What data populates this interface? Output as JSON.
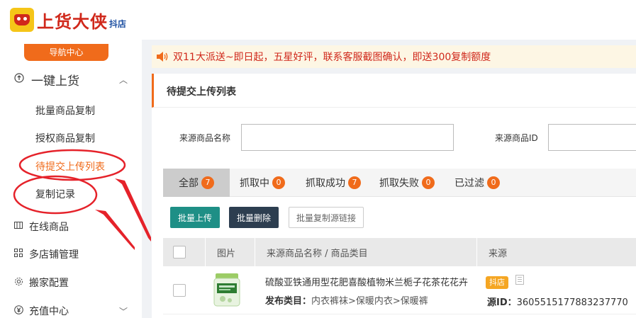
{
  "brand": {
    "name": "上货大侠",
    "sub": "抖店"
  },
  "sidebar": {
    "nav_center": "导航中心",
    "group": {
      "label": "一键上货",
      "icon": "upload-circle-icon",
      "chevron": "︿"
    },
    "sub_items": [
      {
        "label": "批量商品复制"
      },
      {
        "label": "授权商品复制"
      },
      {
        "label": "待提交上传列表"
      },
      {
        "label": "复制记录"
      }
    ],
    "items": [
      {
        "label": "在线商品",
        "icon": "grid-icon"
      },
      {
        "label": "多店铺管理",
        "icon": "apps-icon"
      },
      {
        "label": "搬家配置",
        "icon": "gear-icon"
      },
      {
        "label": "充值中心",
        "icon": "yen-icon",
        "chevron": "﹀"
      }
    ]
  },
  "notice": {
    "text": "双11大派送~即日起，五星好评，联系客服截图确认，即送300复制额度"
  },
  "panel": {
    "title": "待提交上传列表"
  },
  "filters": {
    "name_label": "来源商品名称",
    "id_label": "来源商品ID",
    "name_value": "",
    "id_value": ""
  },
  "tabs": [
    {
      "label": "全部",
      "count": "7"
    },
    {
      "label": "抓取中",
      "count": "0"
    },
    {
      "label": "抓取成功",
      "count": "7"
    },
    {
      "label": "抓取失败",
      "count": "0"
    },
    {
      "label": "已过滤",
      "count": "0"
    }
  ],
  "actions": {
    "batch_upload": "批量上传",
    "batch_delete": "批量删除",
    "batch_copy_link": "批量复制源链接"
  },
  "table": {
    "headers": {
      "image": "图片",
      "name": "来源商品名称 / 商品类目",
      "source": "来源"
    },
    "rows": [
      {
        "title": "硫酸亚铁通用型花肥喜酸植物米兰栀子花茶花花卉",
        "category_label": "发布类目：",
        "category": "内衣裤袜>保暖内衣>保暖裤",
        "shop_tag": "抖店",
        "id_label": "源ID：",
        "source_id": "3605515177883237770"
      }
    ]
  },
  "colors": {
    "accent": "#f06b1b",
    "brand_red": "#d0281b",
    "teal": "#1e8f86",
    "navy": "#2d3e50"
  }
}
